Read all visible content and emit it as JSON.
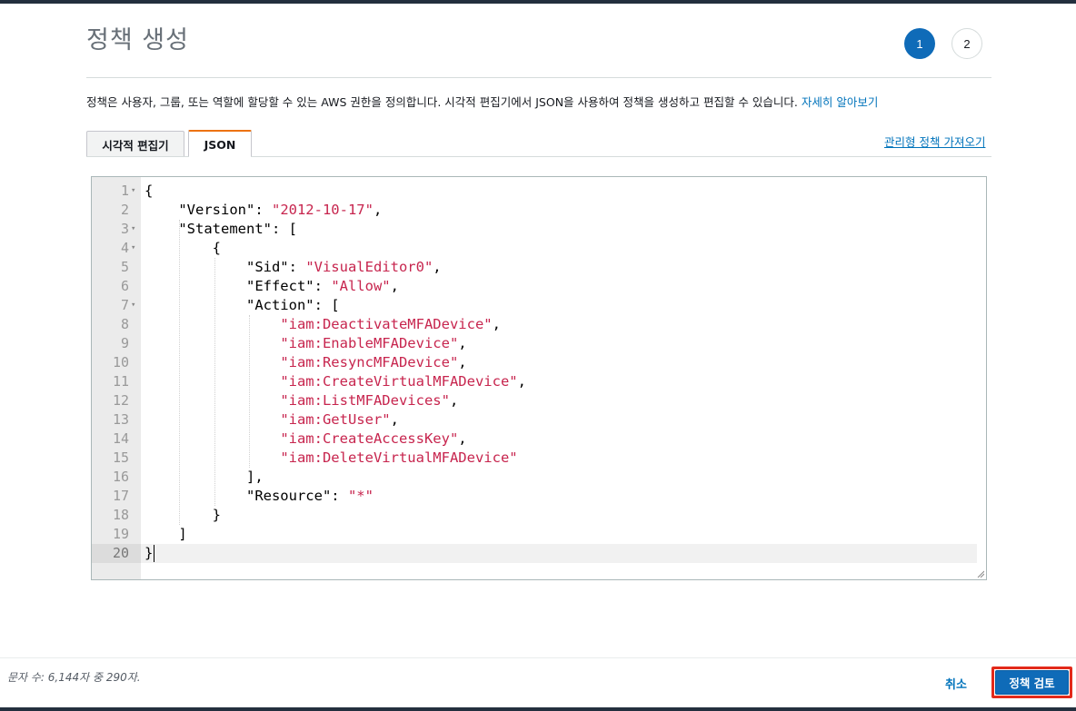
{
  "header": {
    "title": "정책 생성",
    "steps": [
      "1",
      "2"
    ],
    "active_step": 1
  },
  "description": {
    "text": "정책은 사용자, 그룹, 또는 역할에 할당할 수 있는 AWS 권한을 정의합니다. 시각적 편집기에서 JSON을 사용하여 정책을 생성하고 편집할 수 있습니다.",
    "link": "자세히 알아보기"
  },
  "tabs": [
    {
      "label": "시각적 편집기",
      "active": false
    },
    {
      "label": "JSON",
      "active": true
    }
  ],
  "import_link": "관리형 정책 가져오기",
  "editor": {
    "lines": [
      "{",
      "    \"Version\": \"2012-10-17\",",
      "    \"Statement\": [",
      "        {",
      "            \"Sid\": \"VisualEditor0\",",
      "            \"Effect\": \"Allow\",",
      "            \"Action\": [",
      "                \"iam:DeactivateMFADevice\",",
      "                \"iam:EnableMFADevice\",",
      "                \"iam:ResyncMFADevice\",",
      "                \"iam:CreateVirtualMFADevice\",",
      "                \"iam:ListMFADevices\",",
      "                \"iam:GetUser\",",
      "                \"iam:CreateAccessKey\",",
      "                \"iam:DeleteVirtualMFADevice\"",
      "            ],",
      "            \"Resource\": \"*\"",
      "        }",
      "    ]",
      "}"
    ],
    "fold_lines": [
      1,
      3,
      4,
      7
    ],
    "active_line": 20
  },
  "footer": {
    "char_count": "문자 수: 6,144자 중 290자.",
    "cancel_label": "취소",
    "review_label": "정책 검토"
  },
  "colors": {
    "primary": "#0f6bb8",
    "link": "#0073bb",
    "string": "#c7254e",
    "tab_accent": "#ec7211",
    "highlight": "#e3291a"
  }
}
